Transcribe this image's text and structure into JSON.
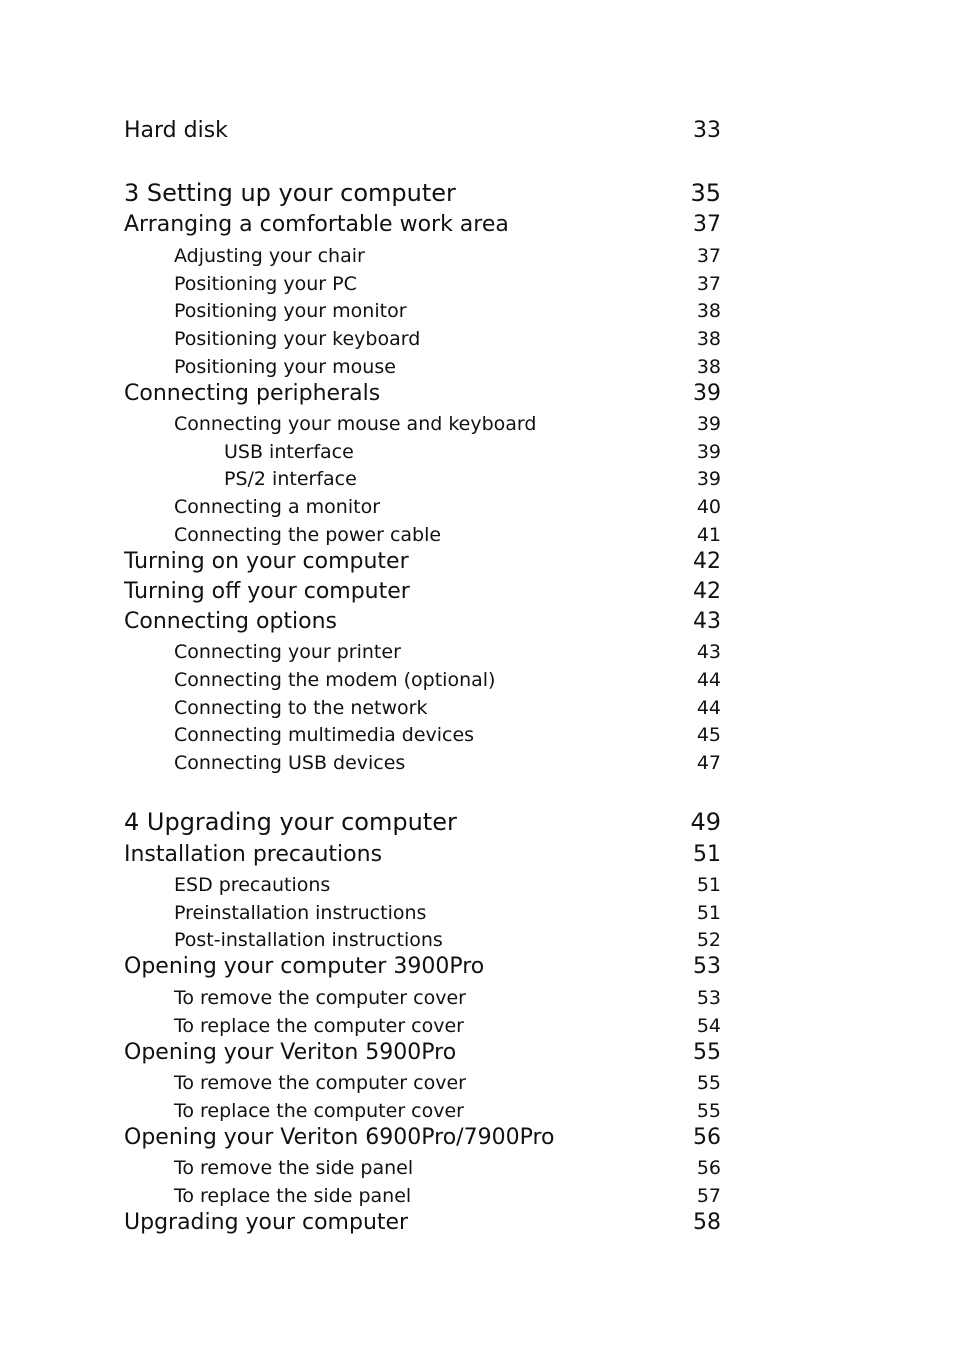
{
  "toc": [
    {
      "level": 1,
      "title": "Hard disk",
      "page": "33"
    },
    {
      "level": 0,
      "title": "3  Setting up your computer",
      "page": "35"
    },
    {
      "level": 1,
      "title": "Arranging a comfortable work area",
      "page": "37"
    },
    {
      "level": 2,
      "title": "Adjusting your chair",
      "page": "37"
    },
    {
      "level": 2,
      "title": "Positioning your PC",
      "page": "37"
    },
    {
      "level": 2,
      "title": "Positioning your monitor",
      "page": "38"
    },
    {
      "level": 2,
      "title": "Positioning your keyboard",
      "page": "38"
    },
    {
      "level": 2,
      "title": "Positioning your mouse",
      "page": "38"
    },
    {
      "level": 1,
      "title": "Connecting peripherals",
      "page": "39"
    },
    {
      "level": 2,
      "title": "Connecting your mouse and keyboard",
      "page": "39"
    },
    {
      "level": 3,
      "title": "USB interface",
      "page": "39"
    },
    {
      "level": 3,
      "title": "PS/2 interface",
      "page": "39"
    },
    {
      "level": 2,
      "title": "Connecting a monitor",
      "page": "40"
    },
    {
      "level": 2,
      "title": "Connecting the power cable",
      "page": "41"
    },
    {
      "level": 1,
      "title": "Turning on your computer",
      "page": "42"
    },
    {
      "level": 1,
      "title": "Turning off your computer",
      "page": "42"
    },
    {
      "level": 1,
      "title": "Connecting options",
      "page": "43"
    },
    {
      "level": 2,
      "title": "Connecting your printer",
      "page": "43"
    },
    {
      "level": 2,
      "title": "Connecting the modem (optional)",
      "page": "44"
    },
    {
      "level": 2,
      "title": "Connecting to the network",
      "page": "44"
    },
    {
      "level": 2,
      "title": "Connecting multimedia devices",
      "page": "45"
    },
    {
      "level": 2,
      "title": "Connecting USB devices",
      "page": "47"
    },
    {
      "level": 0,
      "title": "4  Upgrading your computer",
      "page": "49"
    },
    {
      "level": 1,
      "title": "Installation precautions",
      "page": "51"
    },
    {
      "level": 2,
      "title": "ESD precautions",
      "page": "51"
    },
    {
      "level": 2,
      "title": "Preinstallation instructions",
      "page": "51"
    },
    {
      "level": 2,
      "title": "Post-installation instructions",
      "page": "52"
    },
    {
      "level": 1,
      "title": "Opening your computer 3900Pro",
      "page": "53"
    },
    {
      "level": 2,
      "title": "To remove the computer cover",
      "page": "53"
    },
    {
      "level": 2,
      "title": "To replace the computer cover",
      "page": "54"
    },
    {
      "level": 1,
      "title": "Opening your Veriton 5900Pro",
      "page": "55"
    },
    {
      "level": 2,
      "title": "To remove the computer cover",
      "page": "55"
    },
    {
      "level": 2,
      "title": "To replace the computer cover",
      "page": "55"
    },
    {
      "level": 1,
      "title": "Opening your Veriton 6900Pro/7900Pro",
      "page": "56"
    },
    {
      "level": 2,
      "title": "To remove the side panel",
      "page": "56"
    },
    {
      "level": 2,
      "title": "To replace the side panel",
      "page": "57"
    },
    {
      "level": 1,
      "title": "Upgrading your computer",
      "page": "58"
    }
  ]
}
